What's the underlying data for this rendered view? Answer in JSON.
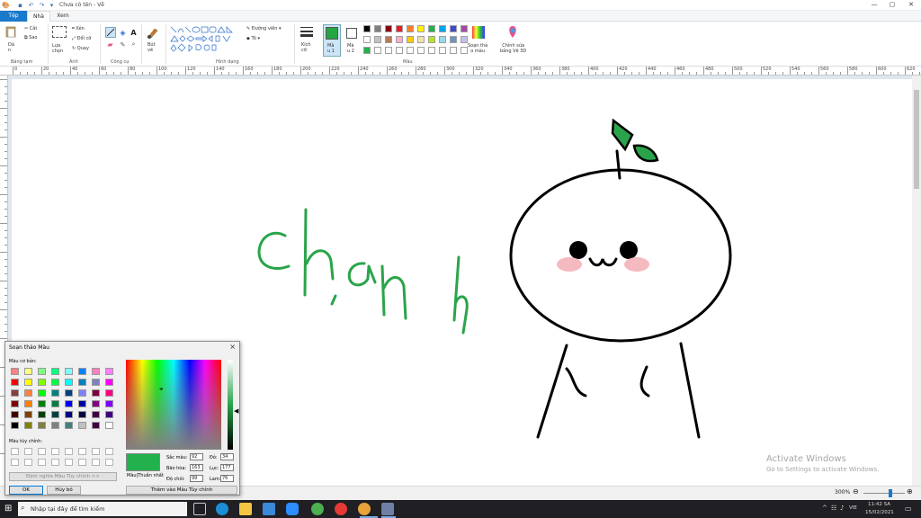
{
  "window": {
    "title": "Chưa có tên - Vẽ",
    "minimize": "—",
    "maximize": "▢",
    "close": "✕"
  },
  "tabs": {
    "file": "Tệp",
    "home": "Nhà",
    "view": "Xem"
  },
  "ribbon": {
    "clipboard": {
      "paste": "Dá\nn",
      "cut": "Cắt",
      "copy": "Sao",
      "group": "Bảng tạm"
    },
    "image": {
      "select": "Lựa\nchọn",
      "crop": "Xén",
      "resize": "Đổi cỡ",
      "rotate": "Quay",
      "group": "Ảnh"
    },
    "tools": {
      "group": "Công cụ"
    },
    "brushes": {
      "label": "Bút\nvẽ",
      "group": ""
    },
    "shapes": {
      "outline": "Đường viền",
      "fill": "Tô",
      "group": "Hình dạng"
    },
    "size": {
      "label": "Kích\ncỡ"
    },
    "color1": {
      "label": "Mà\nu 1",
      "value": "#26a643"
    },
    "color2": {
      "label": "Mà\nu 2",
      "value": "#ffffff"
    },
    "colors_group": "Màu",
    "edit_colors": "Soạn thả\no màu",
    "edit_3d": "Chỉnh sửa\nbằng Vẽ 3D"
  },
  "ruler": {
    "h_labels": [
      "0",
      "20",
      "40",
      "60",
      "80",
      "100",
      "120",
      "140",
      "160",
      "180",
      "200",
      "220",
      "240",
      "260",
      "280",
      "300",
      "320",
      "340",
      "360",
      "380",
      "400",
      "420",
      "440",
      "460",
      "480",
      "500",
      "520",
      "540",
      "560",
      "580",
      "600",
      "620"
    ]
  },
  "canvas": {
    "text": "chanh",
    "ink_green": "#2aa44a",
    "ink_black": "#000000",
    "blush": "#f4b3b8"
  },
  "dialog": {
    "title": "Soạn thảo Màu",
    "basic_label": "Màu cơ bản:",
    "custom_label": "Màu tùy chỉnh:",
    "define_btn": "Định nghĩa Màu Tùy chỉnh >>",
    "ok": "OK",
    "cancel": "Hủy bỏ",
    "add_btn": "Thêm vào Màu Tùy chỉnh",
    "solid_label": "Màu|Thuần nhất",
    "hue_label": "Sắc màu:",
    "hue": "92",
    "sat_label": "Bão hòa:",
    "sat": "163",
    "lum_label": "Độ chói:",
    "lum": "99",
    "red_label": "Đỏ:",
    "red": "34",
    "green_label": "Lục:",
    "green": "177",
    "blue_label": "Lam:",
    "blue": "76",
    "preview": "#22b14c"
  },
  "status": {
    "zoom": "300%"
  },
  "watermark": {
    "line1": "Activate Windows",
    "line2": "Go to Settings to activate Windows."
  },
  "taskbar": {
    "search": "Nhập tại đây để tìm kiếm",
    "lang": "VIE",
    "time": "11:42 SA",
    "date": "15/02/2021"
  }
}
